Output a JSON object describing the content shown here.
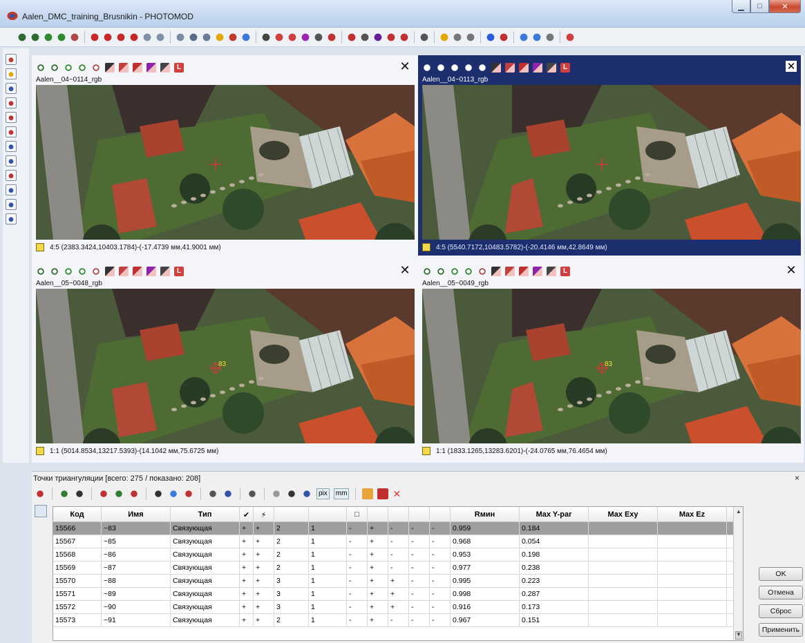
{
  "window": {
    "title": "Aalen_DMC_training_Brusnikin - PHOTOMOD",
    "minimize": "▁",
    "maximize": "□",
    "close": "✕"
  },
  "panes": [
    {
      "image": "Aalen__04~0114_rgb",
      "status": "4:5 (2383.3424,10403.1784)-(-17.4739 мм,41.9001 мм)",
      "marker_label": "",
      "active": false
    },
    {
      "image": "Aalen__04~0113_rgb",
      "status": "4:5 (5540.7172,10483.5782)-(-20.4146 мм,42.8649 мм)",
      "marker_label": "",
      "active": true
    },
    {
      "image": "Aalen__05~0048_rgb",
      "status": "1:1 (5014.8534,13217.5393)-(14.1042 мм,75.6725 мм)",
      "marker_label": "83",
      "active": false
    },
    {
      "image": "Aalen__05~0049_rgb",
      "status": "1:1 (1833.1265,13283.6201)-(-24.0765 мм,76.4654 мм)",
      "marker_label": "83",
      "active": false
    }
  ],
  "pane_tools": {
    "layer_label": "L",
    "close_label": "✕"
  },
  "points_panel": {
    "title": "Точки триангуляции [всего: 275 / показано: 208]",
    "close": "×",
    "pix_label": "pix",
    "mm_label": "mm",
    "columns": [
      "Код",
      "Имя",
      "Тип",
      "✔",
      "⚡",
      "",
      "",
      "□",
      "",
      "",
      "",
      "",
      "Rмин",
      "Max Y-par",
      "Max Exy",
      "Max Ez"
    ],
    "rows": [
      {
        "code": "15566",
        "name": "~83",
        "type": "Связующая",
        "c1": "+",
        "c2": "+",
        "c3": "2",
        "c4": "1",
        "c5": "-",
        "c6": "+",
        "c7": "-",
        "c8": "-",
        "c9": "-",
        "rmin": "0.959",
        "maxy": "0.184",
        "selected": true
      },
      {
        "code": "15567",
        "name": "~85",
        "type": "Связующая",
        "c1": "+",
        "c2": "+",
        "c3": "2",
        "c4": "1",
        "c5": "-",
        "c6": "+",
        "c7": "-",
        "c8": "-",
        "c9": "-",
        "rmin": "0.968",
        "maxy": "0.054",
        "selected": false
      },
      {
        "code": "15568",
        "name": "~86",
        "type": "Связующая",
        "c1": "+",
        "c2": "+",
        "c3": "2",
        "c4": "1",
        "c5": "-",
        "c6": "+",
        "c7": "-",
        "c8": "-",
        "c9": "-",
        "rmin": "0.953",
        "maxy": "0.198",
        "selected": false
      },
      {
        "code": "15569",
        "name": "~87",
        "type": "Связующая",
        "c1": "+",
        "c2": "+",
        "c3": "2",
        "c4": "1",
        "c5": "-",
        "c6": "+",
        "c7": "-",
        "c8": "-",
        "c9": "-",
        "rmin": "0.977",
        "maxy": "0.238",
        "selected": false
      },
      {
        "code": "15570",
        "name": "~88",
        "type": "Связующая",
        "c1": "+",
        "c2": "+",
        "c3": "3",
        "c4": "1",
        "c5": "-",
        "c6": "+",
        "c7": "+",
        "c8": "-",
        "c9": "-",
        "rmin": "0.995",
        "maxy": "0.223",
        "selected": false
      },
      {
        "code": "15571",
        "name": "~89",
        "type": "Связующая",
        "c1": "+",
        "c2": "+",
        "c3": "3",
        "c4": "1",
        "c5": "-",
        "c6": "+",
        "c7": "+",
        "c8": "-",
        "c9": "-",
        "rmin": "0.998",
        "maxy": "0.287",
        "selected": false
      },
      {
        "code": "15572",
        "name": "~90",
        "type": "Связующая",
        "c1": "+",
        "c2": "+",
        "c3": "3",
        "c4": "1",
        "c5": "-",
        "c6": "+",
        "c7": "+",
        "c8": "-",
        "c9": "-",
        "rmin": "0.916",
        "maxy": "0.173",
        "selected": false
      },
      {
        "code": "15573",
        "name": "~91",
        "type": "Связующая",
        "c1": "+",
        "c2": "+",
        "c3": "2",
        "c4": "1",
        "c5": "-",
        "c6": "+",
        "c7": "-",
        "c8": "-",
        "c9": "-",
        "rmin": "0.967",
        "maxy": "0.151",
        "selected": false
      }
    ]
  },
  "buttons": {
    "ok": "OK",
    "cancel": "Отмена",
    "reset": "Сброс",
    "apply": "Применить"
  },
  "colors": {
    "active_pane": "#1c2e6e",
    "selected_row": "#9e9e9e",
    "marker": "#e8333a",
    "label": "#f2e13a"
  }
}
